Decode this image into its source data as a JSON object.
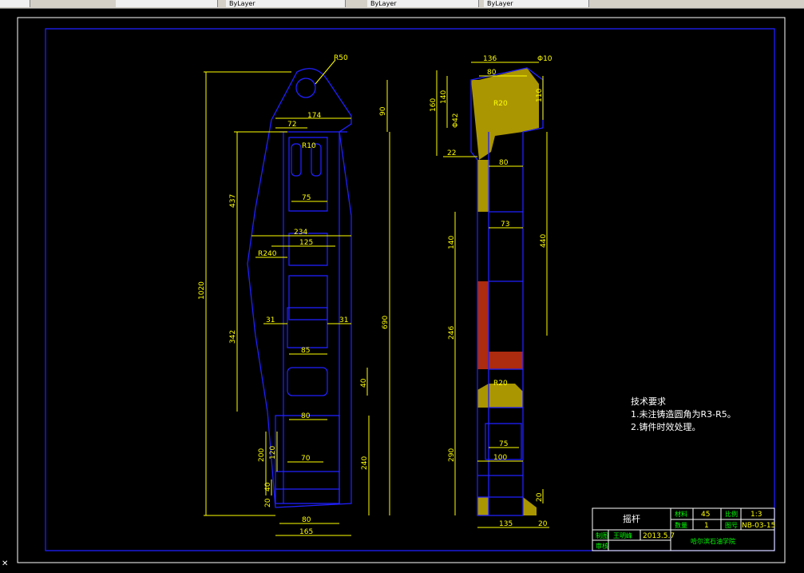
{
  "toolbar": {
    "items": [
      "",
      "ByLayer",
      "ByLayer",
      "ByLayer",
      ""
    ]
  },
  "drawing": {
    "left_view": {
      "r50": "R50",
      "d174": "174",
      "d72": "72",
      "r10": "R10",
      "d90": "90",
      "d437": "437",
      "d75": "75",
      "d234": "234",
      "d125": "125",
      "r240": "R240",
      "d1020": "1020",
      "d342": "342",
      "d690": "690",
      "d31a": "31",
      "d31b": "31",
      "d85": "85",
      "d40": "40",
      "d80a": "80",
      "d200": "200",
      "d120": "120",
      "d70": "70",
      "d240": "240",
      "d40b": "40",
      "d20": "20",
      "d80b": "80",
      "d165": "165"
    },
    "right_view": {
      "d136": "136",
      "phi10": "Φ10",
      "d80": "80",
      "d160": "160",
      "d140a": "140",
      "phi42": "Φ42",
      "r20a": "R20",
      "d110": "110",
      "d22": "22",
      "d80b": "80",
      "d73": "73",
      "d140b": "140",
      "d440": "440",
      "d246": "246",
      "r20b": "R20",
      "d75": "75",
      "d100": "100",
      "d290": "290",
      "d20a": "20",
      "d135": "135",
      "d20b": "20"
    },
    "notes": {
      "heading": "技术要求",
      "line1": "1.未注铸造圆角为R3-R5。",
      "line2": "2.铸件时效处理。"
    },
    "title_block": {
      "name": "摇杆",
      "material_label": "材料",
      "material": "45",
      "scale_label": "比例",
      "scale": "1:3",
      "qty_label": "数量",
      "qty": "1",
      "drawing_no_label": "图号",
      "drawing_no": "NB-03-15",
      "designer_label": "制图",
      "designer": "王明峰",
      "date": "2013.5.7",
      "checker_label": "审核",
      "school": "哈尔滨石油学院"
    }
  },
  "colors": {
    "background": "#000000",
    "frame": "#2020ff",
    "dimension": "#ffff00",
    "hatch_yellow": "#c8b000",
    "hatch_red": "#c03010"
  }
}
